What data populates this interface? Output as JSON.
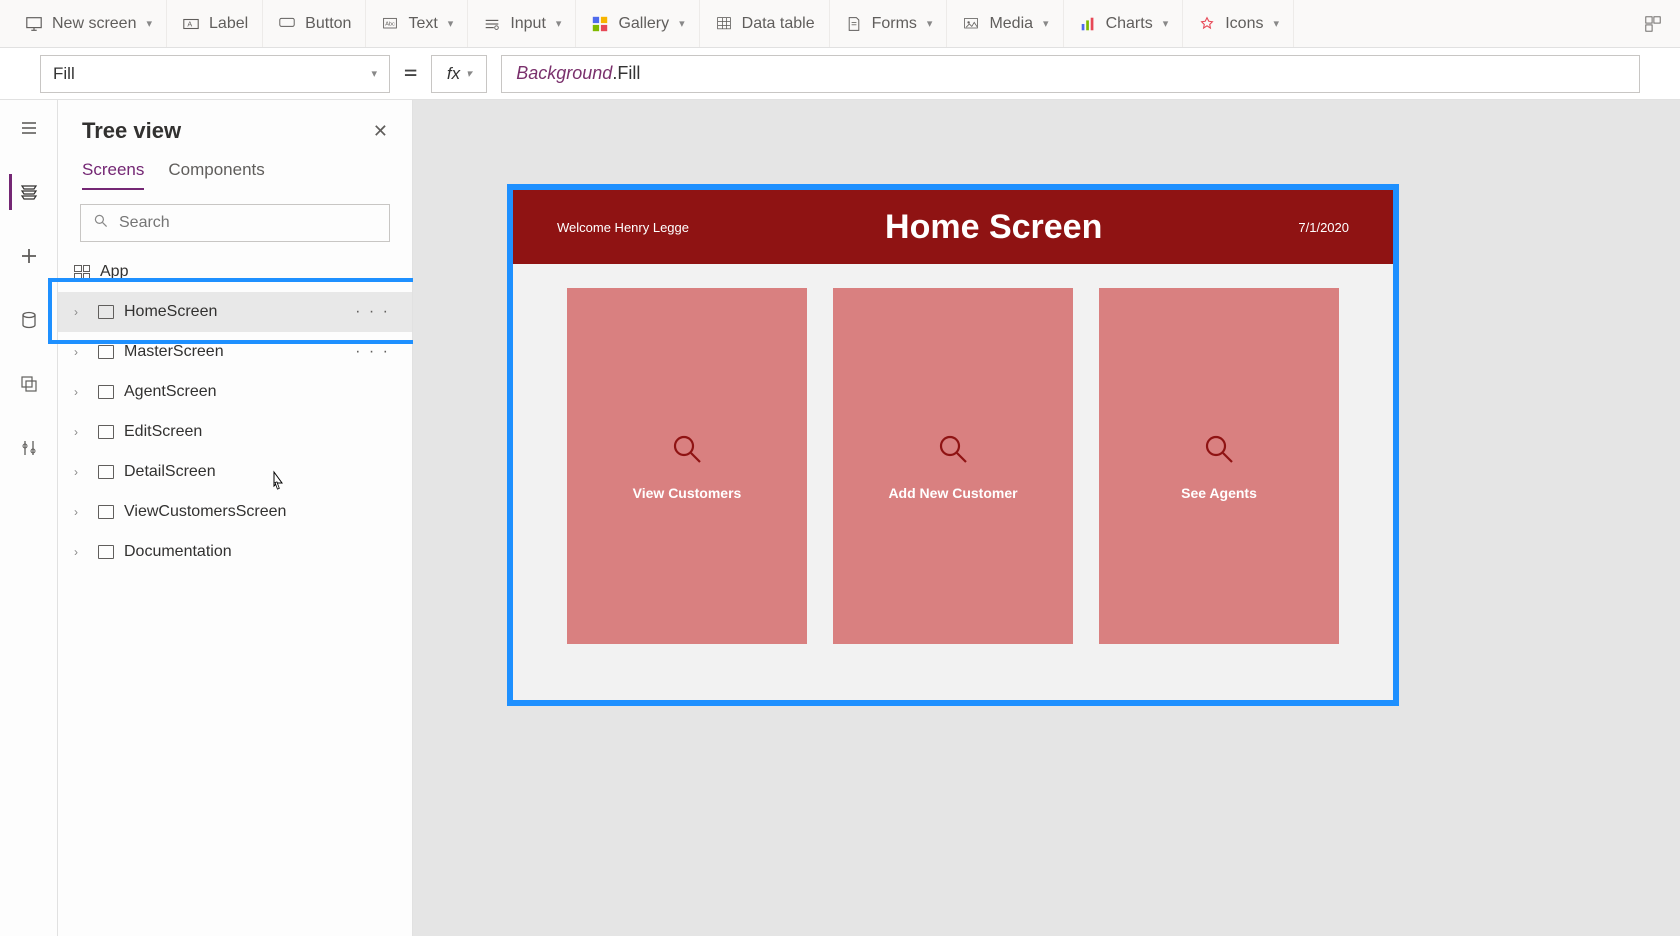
{
  "ribbon": {
    "new_screen": "New screen",
    "label": "Label",
    "button": "Button",
    "text": "Text",
    "input": "Input",
    "gallery": "Gallery",
    "data_table": "Data table",
    "forms": "Forms",
    "media": "Media",
    "charts": "Charts",
    "icons": "Icons"
  },
  "formula": {
    "property": "Fill",
    "fx": "fx",
    "ref": "Background",
    "suffix": ".Fill",
    "equals": "="
  },
  "tree": {
    "title": "Tree view",
    "tabs": {
      "screens": "Screens",
      "components": "Components"
    },
    "search_placeholder": "Search",
    "items": [
      {
        "label": "App",
        "isApp": true
      },
      {
        "label": "HomeScreen",
        "selected": true,
        "dots": true
      },
      {
        "label": "MasterScreen",
        "dots": true
      },
      {
        "label": "AgentScreen"
      },
      {
        "label": "EditScreen"
      },
      {
        "label": "DetailScreen"
      },
      {
        "label": "ViewCustomersScreen"
      },
      {
        "label": "Documentation"
      }
    ]
  },
  "screen": {
    "welcome": "Welcome Henry Legge",
    "title": "Home Screen",
    "date": "7/1/2020",
    "cards": [
      {
        "label": "View Customers"
      },
      {
        "label": "Add New Customer"
      },
      {
        "label": "See Agents"
      }
    ]
  }
}
